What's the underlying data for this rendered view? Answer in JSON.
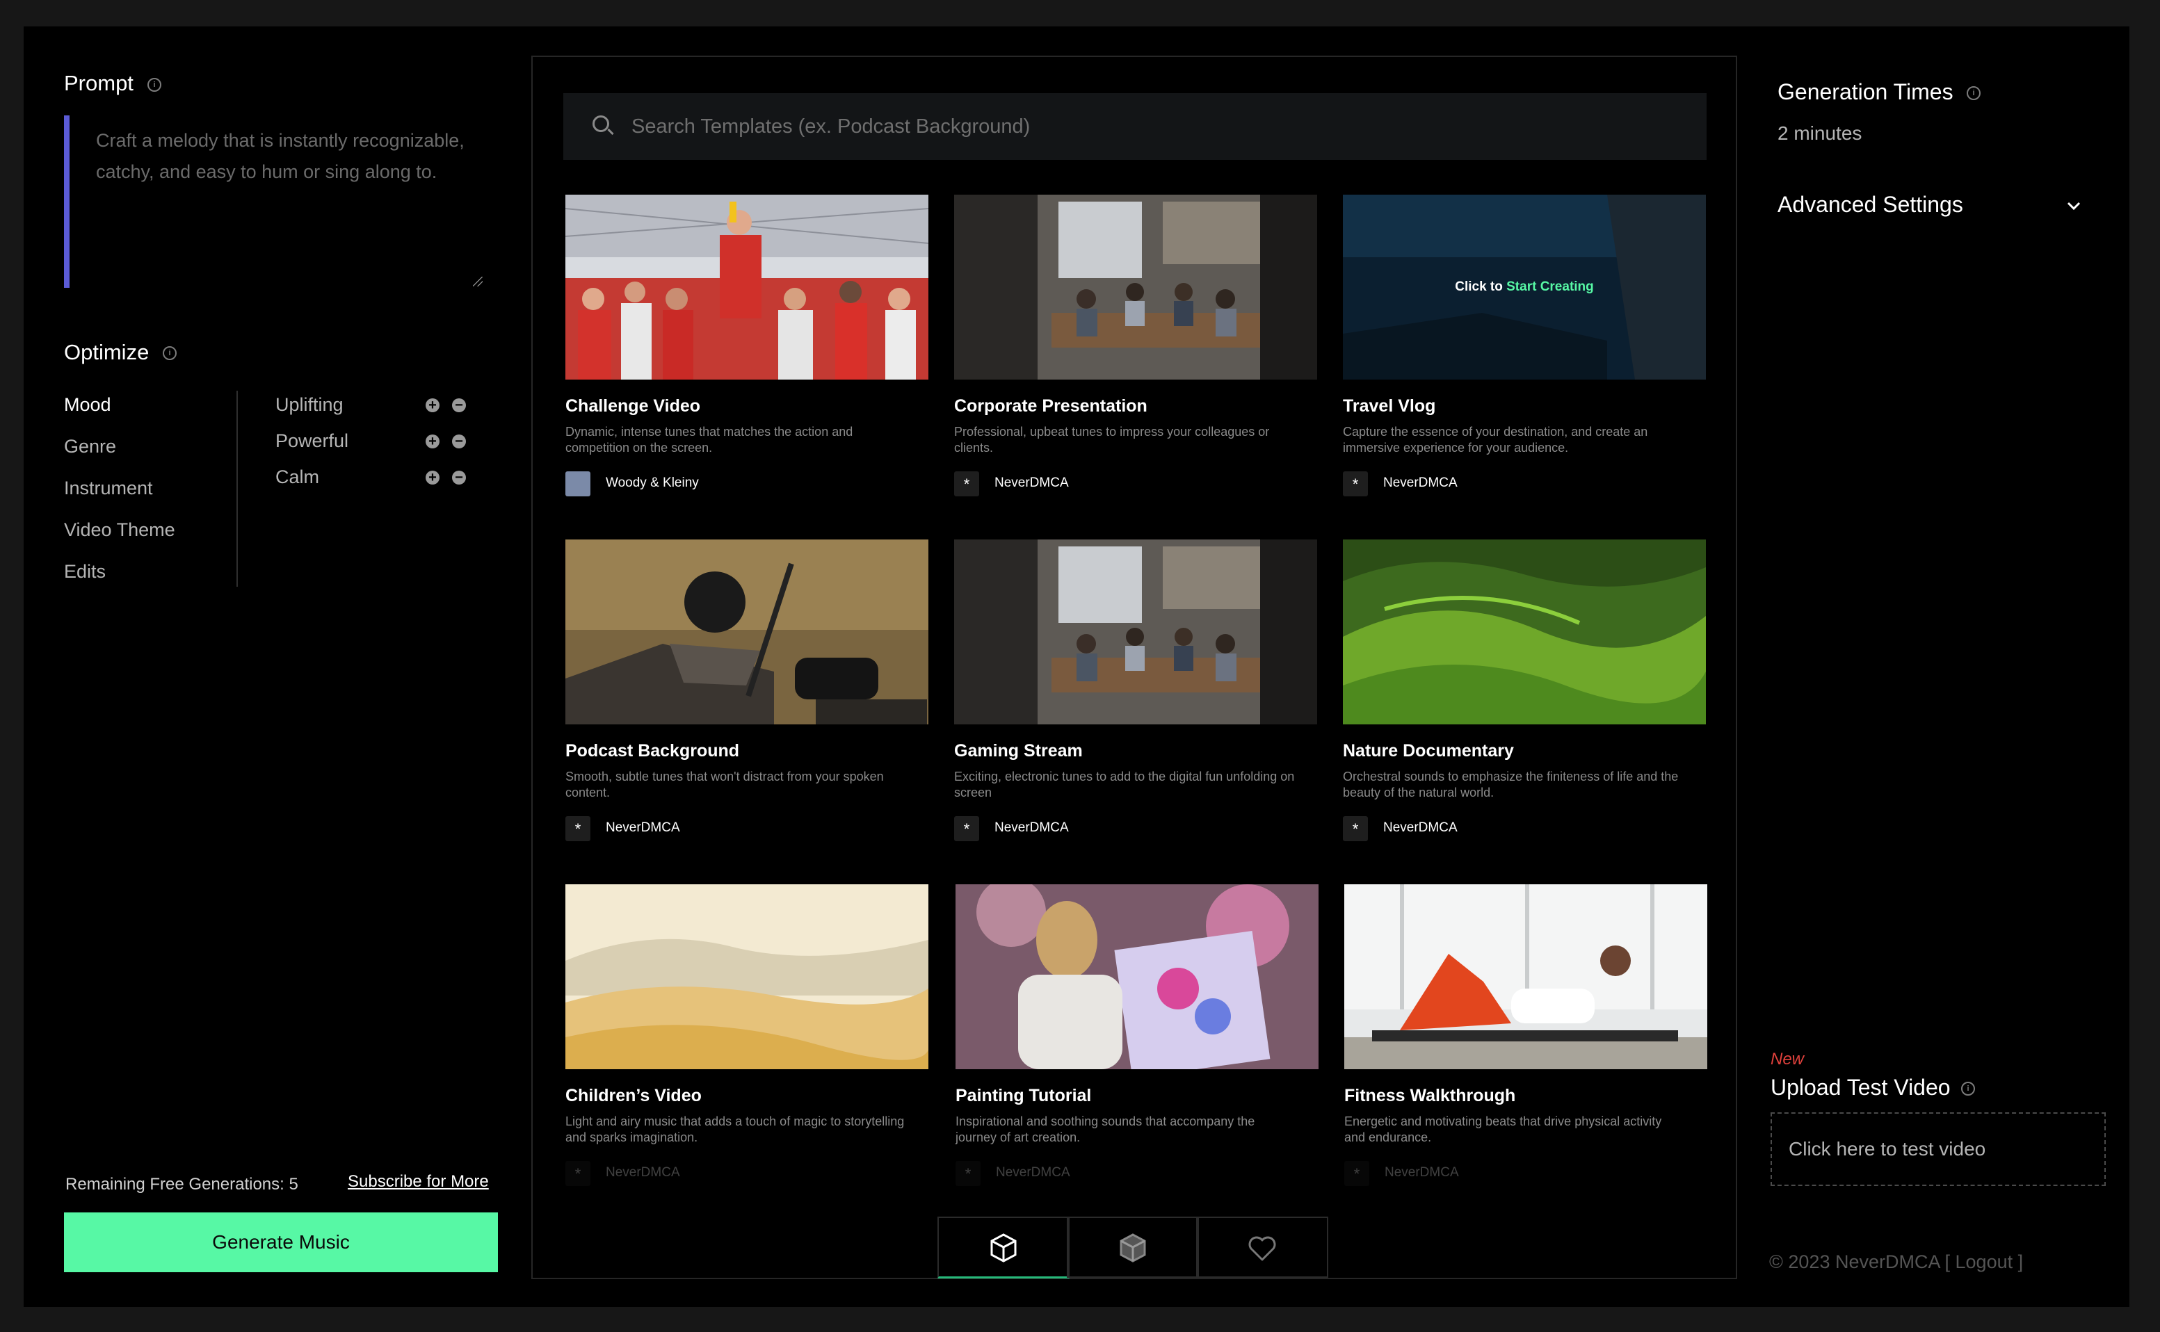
{
  "left": {
    "prompt_label": "Prompt",
    "prompt_placeholder": "Craft a melody that is instantly recognizable, catchy, and easy to hum or sing along to.",
    "optimize_label": "Optimize",
    "categories": [
      "Mood",
      "Genre",
      "Instrument",
      "Video Theme",
      "Edits"
    ],
    "mood_options": [
      "Uplifting",
      "Powerful",
      "Calm"
    ],
    "remaining_text": "Remaining Free Generations: 5",
    "subscribe_label": "Subscribe for More",
    "generate_label": "Generate Music"
  },
  "center": {
    "search_placeholder": "Search Templates (ex. Podcast Background)",
    "overlay_prefix": "Click to ",
    "overlay_accent": "Start Creating",
    "cards": [
      {
        "title": "Challenge Video",
        "desc": "Dynamic, intense tunes that matches the action and competition on the screen.",
        "author": "Woody & Kleiny"
      },
      {
        "title": "Corporate Presentation",
        "desc": "Professional, upbeat tunes to impress your colleagues or clients.",
        "author": "NeverDMCA"
      },
      {
        "title": "Travel Vlog",
        "desc": "Capture the essence of your destination, and create an immersive experience for your audience.",
        "author": "NeverDMCA"
      },
      {
        "title": "Podcast Background",
        "desc": "Smooth, subtle tunes that won't distract from your spoken content.",
        "author": "NeverDMCA"
      },
      {
        "title": "Gaming Stream",
        "desc": "Exciting, electronic tunes to add to the digital fun unfolding on screen",
        "author": "NeverDMCA"
      },
      {
        "title": "Nature Documentary",
        "desc": "Orchestral sounds to emphasize the finiteness of life and the beauty of the natural world.",
        "author": "NeverDMCA"
      },
      {
        "title": "Children’s Video",
        "desc": "Light and airy music that adds a touch of magic to storytelling and sparks imagination.",
        "author": "NeverDMCA"
      },
      {
        "title": "Painting Tutorial",
        "desc": "Inspirational and soothing sounds that accompany the journey of art creation.",
        "author": "NeverDMCA"
      },
      {
        "title": "Fitness Walkthrough",
        "desc": "Energetic and motivating beats that drive physical activity and endurance.",
        "author": "NeverDMCA"
      }
    ],
    "tabs": [
      "cube-icon",
      "cube-filled-icon",
      "heart-icon"
    ]
  },
  "right": {
    "generation_times_label": "Generation Times",
    "generation_times_value": "2 minutes",
    "advanced_label": "Advanced Settings",
    "new_label": "New",
    "upload_label": "Upload Test Video",
    "upload_box_text": "Click here to test video",
    "footer_copyright": "© 2023 NeverDMCA",
    "logout_label": "[ Logout ]"
  },
  "colors": {
    "accent_green": "#57f8a5",
    "prompt_bar": "#5b5bd6",
    "new_red": "#e0413c"
  }
}
